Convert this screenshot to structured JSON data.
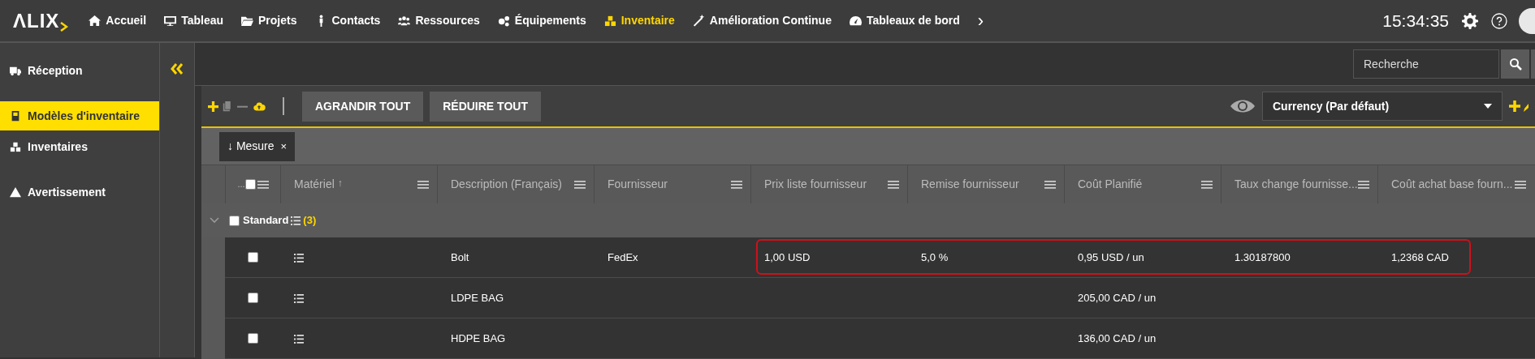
{
  "top_nav": {
    "logo": "ΛLIX",
    "items": [
      {
        "label": "Accueil",
        "selected": false
      },
      {
        "label": "Tableau",
        "selected": false
      },
      {
        "label": "Projets",
        "selected": false
      },
      {
        "label": "Contacts",
        "selected": false
      },
      {
        "label": "Ressources",
        "selected": false
      },
      {
        "label": "Équipements",
        "selected": false
      },
      {
        "label": "Inventaire",
        "selected": true
      },
      {
        "label": "Amélioration Continue",
        "selected": false
      },
      {
        "label": "Tableaux de bord",
        "selected": false
      }
    ],
    "more": "›",
    "time": "15:34:35"
  },
  "sidebar": {
    "items": [
      {
        "label": "Réception",
        "selected": false
      },
      {
        "label": "Modèles d'inventaire",
        "selected": true
      },
      {
        "label": "Inventaires",
        "selected": false
      },
      {
        "label": "Avertissement",
        "selected": false
      }
    ]
  },
  "search": {
    "placeholder": "Recherche"
  },
  "toolbar": {
    "buttons": [
      "AGRANDIR TOUT",
      "RÉDUIRE TOUT"
    ],
    "view": "Currency (Par défaut)"
  },
  "grouping": {
    "chip": "↓ Mesure",
    "remove": "×"
  },
  "table": {
    "select_all_label": "...",
    "select_all_checked": false,
    "columns": [
      {
        "label": "Matériel",
        "sort": "↑"
      },
      {
        "label": "Description (Français)"
      },
      {
        "label": "Fournisseur"
      },
      {
        "label": "Prix liste fournisseur"
      },
      {
        "label": "Remise fournisseur"
      },
      {
        "label": "Coût Planifié"
      },
      {
        "label": "Taux change fournisse..."
      },
      {
        "label": "Coût achat base fourn..."
      }
    ],
    "groups": [
      {
        "label": "Standard",
        "count": "(3)",
        "expanded": true,
        "checked": false,
        "rows": [
          {
            "checked": false,
            "highlighted": true,
            "description": "Bolt",
            "supplier": "FedEx",
            "list_price": "1,00 USD",
            "discount": "5,0 %",
            "planned_cost": "0,95 USD / un",
            "exchange_rate": "1.30187800",
            "base_cost": "1,2368 CAD"
          },
          {
            "checked": false,
            "highlighted": false,
            "description": "LDPE BAG",
            "planned_cost": "205,00 CAD / un"
          },
          {
            "checked": false,
            "highlighted": false,
            "description": "HDPE BAG",
            "planned_cost": "136,00 CAD / un"
          }
        ]
      }
    ]
  }
}
